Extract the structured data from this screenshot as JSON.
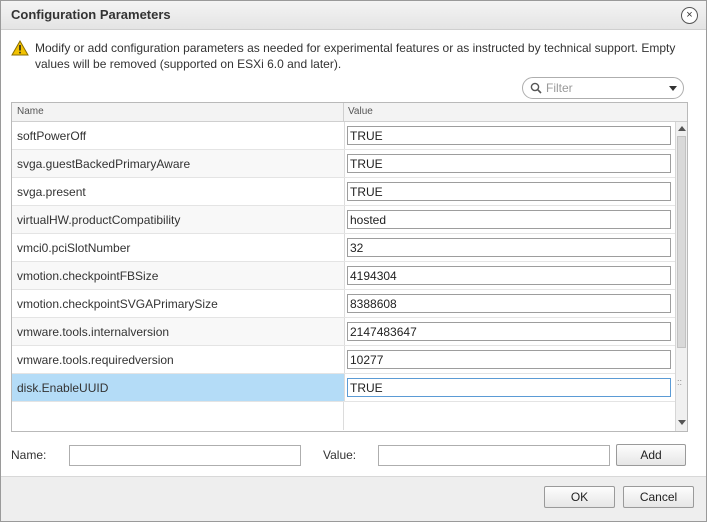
{
  "dialog": {
    "title": "Configuration Parameters",
    "close_label": "×",
    "message": "Modify or add configuration parameters as needed for experimental features or as instructed by technical support. Empty values will be removed (supported on ESXi 6.0 and later)."
  },
  "filter": {
    "placeholder": "Filter"
  },
  "grid": {
    "columns": [
      "Name",
      "Value"
    ],
    "rows": [
      {
        "name": "softPowerOff",
        "value": "TRUE"
      },
      {
        "name": "svga.guestBackedPrimaryAware",
        "value": "TRUE"
      },
      {
        "name": "svga.present",
        "value": "TRUE"
      },
      {
        "name": "virtualHW.productCompatibility",
        "value": "hosted"
      },
      {
        "name": "vmci0.pciSlotNumber",
        "value": "32"
      },
      {
        "name": "vmotion.checkpointFBSize",
        "value": "4194304"
      },
      {
        "name": "vmotion.checkpointSVGAPrimarySize",
        "value": "8388608"
      },
      {
        "name": "vmware.tools.internalversion",
        "value": "2147483647"
      },
      {
        "name": "vmware.tools.requiredversion",
        "value": "10277"
      },
      {
        "name": "disk.EnableUUID",
        "value": "TRUE"
      }
    ],
    "selected_row_name": "disk.EnableUUID"
  },
  "add_form": {
    "name_label": "Name:",
    "name_value": "",
    "value_label": "Value:",
    "value_value": "",
    "add_label": "Add"
  },
  "footer": {
    "ok_label": "OK",
    "cancel_label": "Cancel"
  },
  "colors": {
    "selected_row": "#b4dcf7",
    "warning": "#f2c200"
  }
}
